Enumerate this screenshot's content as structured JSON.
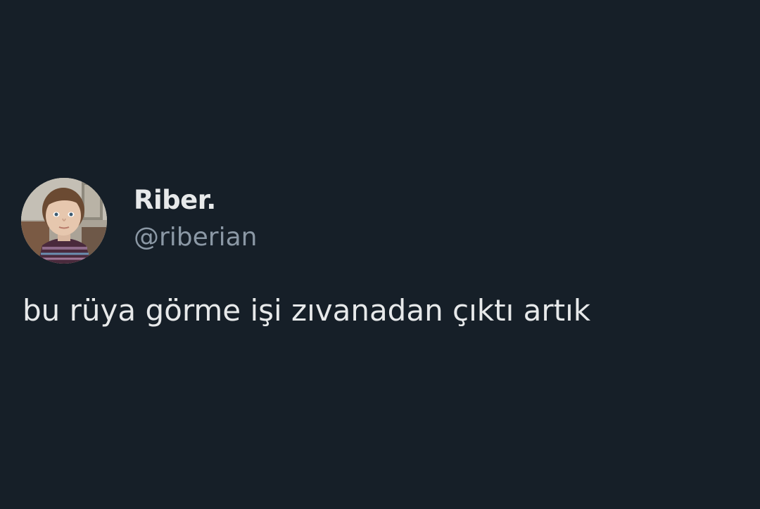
{
  "tweet": {
    "author": {
      "display_name": "Riber.",
      "handle": "@riberian",
      "avatar_icon": "profile-photo-child"
    },
    "text": "bu rüya görme işi zıvanadan çıktı artık"
  },
  "colors": {
    "background": "#161f28",
    "primary_text": "#e7e9ea",
    "secondary_text": "#8b98a5"
  }
}
